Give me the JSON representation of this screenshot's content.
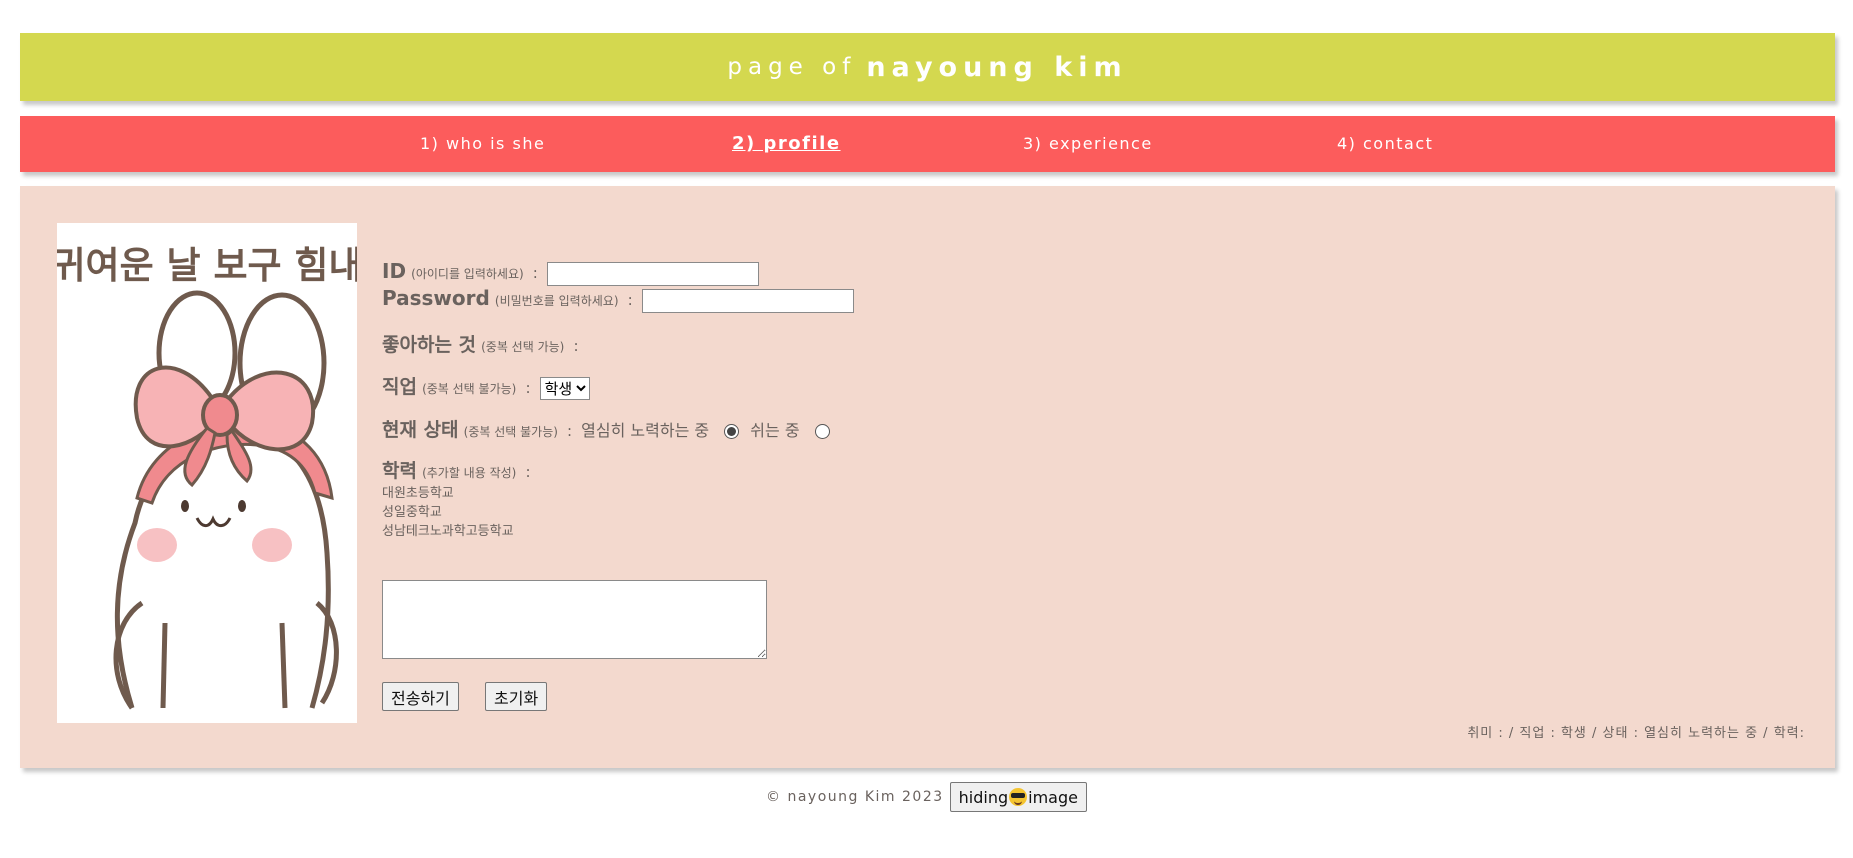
{
  "header": {
    "prefix": "page of",
    "name": "nayoung kim"
  },
  "nav": {
    "items": [
      {
        "label": "1) who is she",
        "active": false
      },
      {
        "label": "2) profile",
        "active": true
      },
      {
        "label": "3) experience",
        "active": false
      },
      {
        "label": "4) contact",
        "active": false
      }
    ]
  },
  "photo": {
    "caption": "귀여운 날 보구 힘내"
  },
  "form": {
    "id": {
      "label": "ID",
      "hint": "(아이디를 입력하세요)",
      "colon": ":",
      "value": ""
    },
    "password": {
      "label": "Password",
      "hint": "(비밀번호를 입력하세요)",
      "colon": ":",
      "value": ""
    },
    "likes": {
      "label": "좋아하는 것",
      "hint": "(중복 선택 가능)",
      "colon": ":"
    },
    "job": {
      "label": "직업",
      "hint": "(중복 선택 불가능)",
      "colon": ":",
      "selected": "학생"
    },
    "status": {
      "label": "현재 상태",
      "hint": "(중복 선택 불가능)",
      "colon": ":",
      "options": [
        {
          "label": "열심히 노력하는 중",
          "checked": true
        },
        {
          "label": "쉬는 중",
          "checked": false
        }
      ]
    },
    "education": {
      "label": "학력",
      "hint": "(추가할 내용 작성)",
      "colon": ":",
      "schools": [
        "대원초등학교",
        "성일중학교",
        "성남테크노과학고등학교"
      ]
    },
    "textarea_value": "",
    "submit_label": "전송하기",
    "reset_label": "초기화"
  },
  "summary": "취미 :  / 직업 : 학생 / 상태 : 열심히 노력하는 중 / 학력:",
  "footer": {
    "copyright": "© nayoung Kim 2023",
    "toggle_label_left": "hiding",
    "toggle_emoji": "sunglasses-face-icon",
    "toggle_label_right": "image"
  }
}
